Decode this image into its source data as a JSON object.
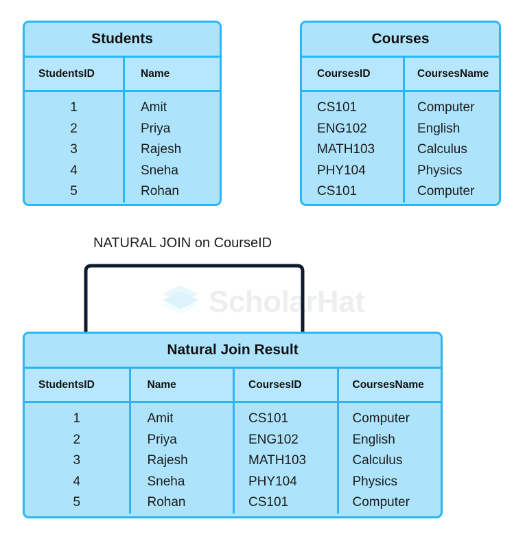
{
  "diagram": {
    "title": "SQL NATURAL JOIN diagram",
    "colors": {
      "table_border": "#29b6f6",
      "table_fill": "#aee4fb",
      "header_fill": "#b7e7fc",
      "bracket": "#0c1c2e",
      "watermark_text": "#eceef0",
      "watermark_logo": "#e8f7fd",
      "text": "#111111",
      "background": "#ffffff"
    }
  },
  "watermark": {
    "brand": "ScholarHat",
    "logo_icon": "layered-stack-icon"
  },
  "students_table": {
    "title": "Students",
    "columns": [
      "StudentsID",
      "Name"
    ],
    "rows": [
      [
        "1",
        "Amit"
      ],
      [
        "2",
        "Priya"
      ],
      [
        "3",
        "Rajesh"
      ],
      [
        "4",
        "Sneha"
      ],
      [
        "5",
        "Rohan"
      ]
    ],
    "ids": [
      "1",
      "2",
      "3",
      "4",
      "5"
    ],
    "names": [
      "Amit",
      "Priya",
      "Rajesh",
      "Sneha",
      "Rohan"
    ]
  },
  "courses_table": {
    "title": "Courses",
    "columns": [
      "CoursesID",
      "CoursesName"
    ],
    "rows": [
      [
        "CS101",
        "Computer"
      ],
      [
        "ENG102",
        "English"
      ],
      [
        "MATH103",
        "Calculus"
      ],
      [
        "PHY104",
        "Physics"
      ],
      [
        "CS101",
        "Computer"
      ]
    ],
    "ids": [
      "CS101",
      "ENG102",
      "MATH103",
      "PHY104",
      "CS101"
    ],
    "names": [
      "Computer",
      "English",
      "Calculus",
      "Physics",
      "Computer"
    ]
  },
  "join_operation": {
    "label": "NATURAL JOIN on CourseID"
  },
  "result_table": {
    "title": "Natural Join Result",
    "columns": [
      "StudentsID",
      "Name",
      "CoursesID",
      "CoursesName"
    ],
    "rows": [
      [
        "1",
        "Amit",
        "CS101",
        "Computer"
      ],
      [
        "2",
        "Priya",
        "ENG102",
        "English"
      ],
      [
        "3",
        "Rajesh",
        "MATH103",
        "Calculus"
      ],
      [
        "4",
        "Sneha",
        "PHY104",
        "Physics"
      ],
      [
        "5",
        "Rohan",
        "CS101",
        "Computer"
      ]
    ],
    "student_ids": [
      "1",
      "2",
      "3",
      "4",
      "5"
    ],
    "student_names": [
      "Amit",
      "Priya",
      "Rajesh",
      "Sneha",
      "Rohan"
    ],
    "course_ids": [
      "CS101",
      "ENG102",
      "MATH103",
      "PHY104",
      "CS101"
    ],
    "course_names": [
      "Computer",
      "English",
      "Calculus",
      "Physics",
      "Computer"
    ]
  }
}
